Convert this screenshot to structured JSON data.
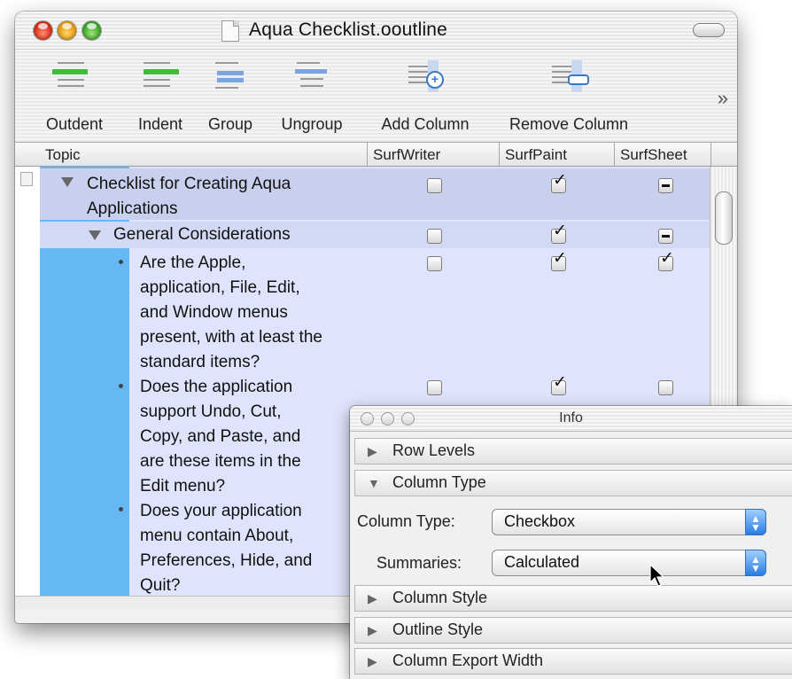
{
  "window": {
    "title": "Aqua Checklist.ooutline"
  },
  "toolbar": {
    "items": [
      {
        "label": "Outdent"
      },
      {
        "label": "Indent"
      },
      {
        "label": "Group"
      },
      {
        "label": "Ungroup"
      },
      {
        "label": "Add Column"
      },
      {
        "label": "Remove Column"
      }
    ],
    "overflow": "»"
  },
  "columns": [
    "Topic",
    "SurfWriter",
    "SurfPaint",
    "SurfSheet"
  ],
  "rows": [
    {
      "text_lines": [
        "Checklist for Creating Aqua",
        "Applications"
      ],
      "level": 0,
      "disclosure": "expanded",
      "values": [
        "unchecked",
        "checked",
        "mixed"
      ]
    },
    {
      "text_lines": [
        "General Considerations"
      ],
      "level": 1,
      "disclosure": "expanded",
      "values": [
        "unchecked",
        "checked",
        "mixed"
      ]
    },
    {
      "text_lines": [
        "Are the Apple,",
        "application, File, Edit,",
        "and Window menus",
        "present, with at least the",
        "standard items?"
      ],
      "level": 2,
      "bullet": true,
      "values": [
        "unchecked",
        "checked",
        "checked"
      ]
    },
    {
      "text_lines": [
        "Does the application",
        "support Undo, Cut,",
        "Copy, and Paste, and",
        "are these items in the",
        "Edit menu?"
      ],
      "level": 2,
      "bullet": true,
      "values": [
        "unchecked",
        "checked",
        "unchecked"
      ]
    },
    {
      "text_lines": [
        "Does your application",
        "menu contain About,",
        "Preferences, Hide, and",
        "Quit?"
      ],
      "level": 2,
      "bullet": true,
      "values": []
    }
  ],
  "info_panel": {
    "title": "Info",
    "sections": [
      {
        "label": "Row Levels",
        "expanded": false
      },
      {
        "label": "Column Type",
        "expanded": true
      },
      {
        "label": "Column Style",
        "expanded": false
      },
      {
        "label": "Outline Style",
        "expanded": false
      },
      {
        "label": "Column Export Width",
        "expanded": false
      }
    ],
    "column_type_label": "Column Type:",
    "column_type_value": "Checkbox",
    "summaries_label": "Summaries:",
    "summaries_value": "Calculated"
  },
  "colors": {
    "topic_highlight": "#66b8f4",
    "row_lavender": "#dfe4fc",
    "popup_blue": "#2a7be0"
  }
}
